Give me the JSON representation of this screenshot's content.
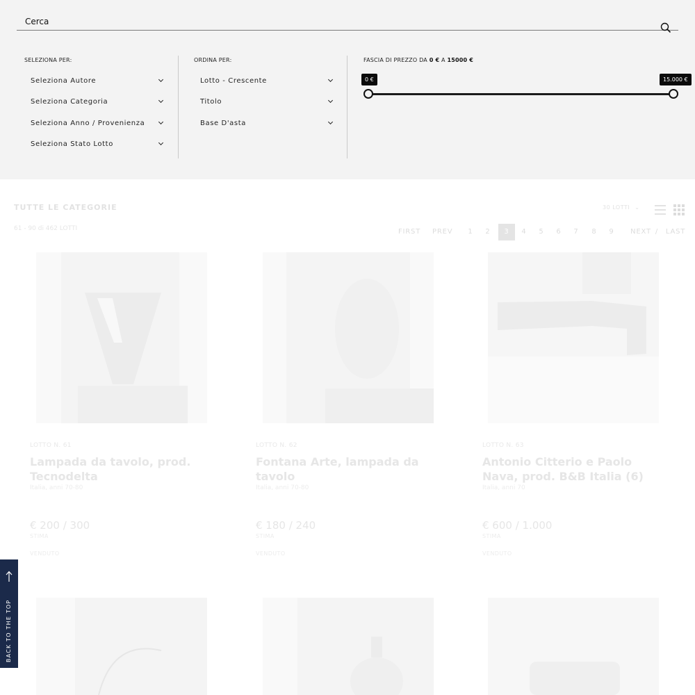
{
  "search": {
    "placeholder": "Cerca"
  },
  "filters": {
    "select_by_label": "SELEZIONA PER:",
    "select_items": [
      "Seleziona Autore",
      "Seleziona Categoria",
      "Seleziona Anno / Provenienza",
      "Seleziona Stato Lotto"
    ],
    "order_by_label": "ORDINA PER:",
    "order_items": [
      "Lotto - Crescente",
      "Titolo",
      "Base D'asta"
    ],
    "price": {
      "label_prefix": "FASCIA DI PREZZO DA",
      "min_label": "0 €",
      "connector": "A",
      "max_label": "15000 €",
      "min_tip": "0 €",
      "max_tip": "15.000 €"
    }
  },
  "listing": {
    "category_title": "TUTTE LE CATEGORIE",
    "count_text": "61 - 90  di 462 LOTTI",
    "per_page": "30 LOTTI",
    "pagination": {
      "first": "FIRST",
      "prev": "PREV",
      "pages": [
        "1",
        "2",
        "3",
        "4",
        "5",
        "6",
        "7",
        "8",
        "9"
      ],
      "current": "3",
      "next": "NEXT",
      "separator": "/",
      "last": "LAST"
    },
    "lots": [
      {
        "lot_no": "LOTTO N. 61",
        "title": "Lampada da tavolo, prod. Tecnodelta",
        "origin": "Italia, anni 70-80",
        "price": "€ 200 / 300",
        "stima": "STIMA",
        "status": "VENDUTO"
      },
      {
        "lot_no": "LOTTO N. 62",
        "title": "Fontana Arte, lampada da tavolo",
        "origin": "Italia, anni 70-80",
        "price": "€ 180 / 240",
        "stima": "STIMA",
        "status": "VENDUTO"
      },
      {
        "lot_no": "LOTTO N. 63",
        "title": "Antonio Citterio e Paolo Nava, prod. B&B Italia (6)",
        "origin": "Italia, anni 70",
        "price": "€ 600 / 1.000",
        "stima": "STIMA",
        "status": "VENDUTO"
      }
    ]
  },
  "back_to_top": "BACK TO THE TOP"
}
